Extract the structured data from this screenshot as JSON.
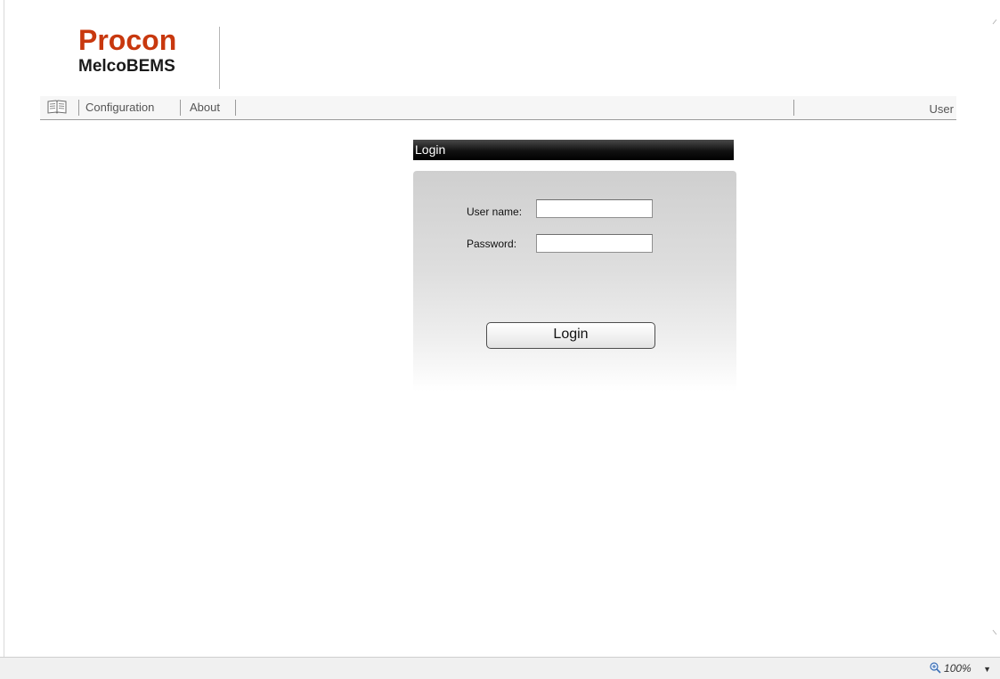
{
  "header": {
    "brand": "Procon",
    "product": "MelcoBEMS"
  },
  "menu": {
    "items": [
      {
        "label": "Configuration"
      },
      {
        "label": "About"
      }
    ],
    "user_label": "User"
  },
  "login": {
    "title": "Login",
    "username_label": "User name:",
    "username_value": "",
    "password_label": "Password:",
    "password_value": "",
    "button_label": "Login"
  },
  "statusbar": {
    "zoom": "100%"
  },
  "colors": {
    "brand": "#c8380e",
    "title_bar": "#000000"
  }
}
